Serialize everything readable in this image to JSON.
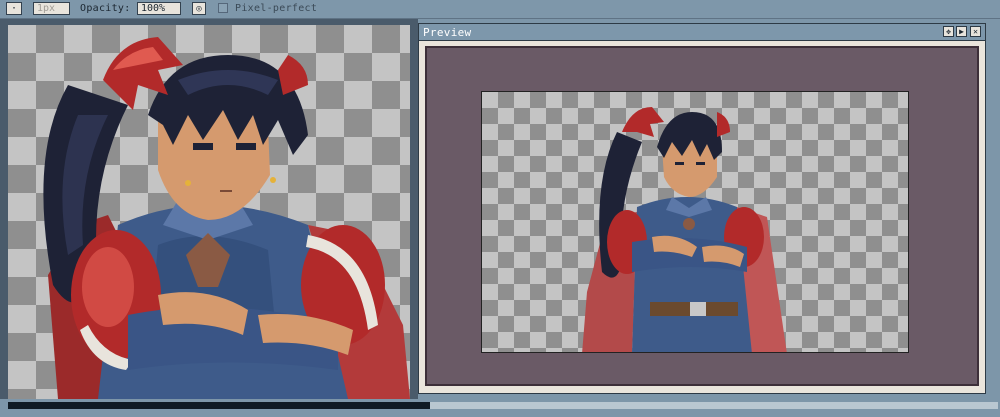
{
  "toolbar": {
    "brush_size_value": "1px",
    "opacity_label": "Opacity:",
    "opacity_value": "100%",
    "pixel_perfect_label": "Pixel-perfect"
  },
  "preview": {
    "title": "Preview"
  },
  "colors": {
    "accent": "#7d97ab",
    "preview_bg": "#6a5a66",
    "checker_light": "#c4c4c4",
    "checker_dark": "#8f8f8f"
  }
}
